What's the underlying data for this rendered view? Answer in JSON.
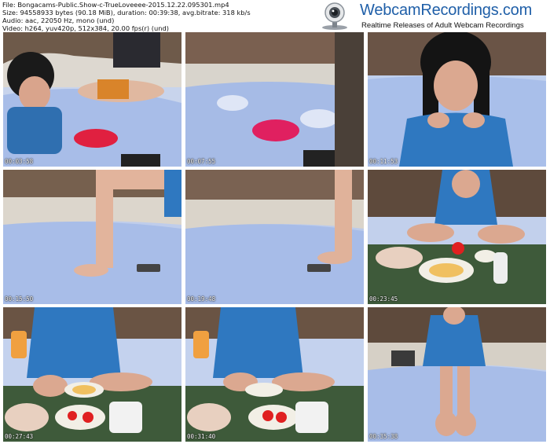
{
  "meta": {
    "file_line": "File: Bongacams-Public.Show-c-TrueLoveeee-2015.12.22.095301.mp4",
    "size_line": "Size: 94558933 bytes (90.18 MiB), duration: 00:39:38, avg.bitrate: 318 kb/s",
    "audio_line": "Audio: aac, 22050 Hz, mono (und)",
    "video_line": "Video: h264, yuv420p, 512x384, 20.00 fps(r) (und)"
  },
  "logo": {
    "title": "WebcamRecordings.com",
    "tagline": "Realtime Releases of Adult Webcam Recordings",
    "icon": "webcam-icon",
    "brand_color": "#1f5fa8"
  },
  "thumbnails": [
    {
      "timestamp": "00:03:58"
    },
    {
      "timestamp": "00:07:55"
    },
    {
      "timestamp": "00:11:53"
    },
    {
      "timestamp": "00:15:50"
    },
    {
      "timestamp": "00:19:48"
    },
    {
      "timestamp": "00:23:45"
    },
    {
      "timestamp": "00:27:43"
    },
    {
      "timestamp": "00:31:40"
    },
    {
      "timestamp": "00:35:38"
    }
  ]
}
